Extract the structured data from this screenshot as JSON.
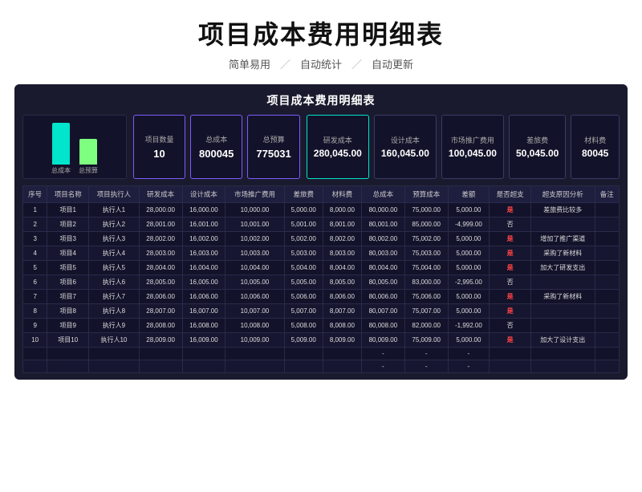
{
  "page": {
    "main_title": "项目成本费用明细表",
    "subtitle_items": [
      "简单易用",
      "自动统计",
      "自动更新"
    ],
    "subtitle_divider": "／"
  },
  "sheet": {
    "title": "项目成本费用明细表",
    "chart": {
      "bars": [
        {
          "label": "总成本",
          "height": 52,
          "color": "#00e5cc"
        },
        {
          "label": "总预算",
          "height": 32,
          "color": "#7fff7f"
        }
      ]
    },
    "stat_boxes": [
      {
        "label": "项目数量",
        "value": "10"
      },
      {
        "label": "总成本",
        "value": "800045"
      },
      {
        "label": "总预算",
        "value": "775031"
      }
    ],
    "right_stats": [
      {
        "label": "研发成本",
        "value": "280,045.00"
      },
      {
        "label": "设计成本",
        "value": "160,045.00"
      },
      {
        "label": "市场推广费用",
        "value": "100,045.00"
      },
      {
        "label": "差旅费",
        "value": "50,045.00"
      },
      {
        "label": "材料费",
        "value": "80045"
      }
    ],
    "table": {
      "headers": [
        "序号",
        "项目名称",
        "项目执行人",
        "研发成本",
        "设计成本",
        "市场推广费用",
        "差旅费",
        "材料费",
        "总成本",
        "预算成本",
        "差额",
        "是否超支",
        "超支原因分析",
        "备注"
      ],
      "rows": [
        [
          "1",
          "项目1",
          "执行人1",
          "28,000.00",
          "16,000.00",
          "10,000.00",
          "5,000.00",
          "8,000.00",
          "80,000.00",
          "75,000.00",
          "5,000.00",
          "是",
          "差旅费比较多",
          ""
        ],
        [
          "2",
          "项目2",
          "执行人2",
          "28,001.00",
          "16,001.00",
          "10,001.00",
          "5,001.00",
          "8,001.00",
          "80,001.00",
          "85,000.00",
          "-4,999.00",
          "否",
          "",
          ""
        ],
        [
          "3",
          "项目3",
          "执行人3",
          "28,002.00",
          "16,002.00",
          "10,002.00",
          "5,002.00",
          "8,002.00",
          "80,002.00",
          "75,002.00",
          "5,000.00",
          "是",
          "增加了推广渠道",
          ""
        ],
        [
          "4",
          "项目4",
          "执行人4",
          "28,003.00",
          "16,003.00",
          "10,003.00",
          "5,003.00",
          "8,003.00",
          "80,003.00",
          "75,003.00",
          "5,000.00",
          "是",
          "采购了新材料",
          ""
        ],
        [
          "5",
          "项目5",
          "执行人5",
          "28,004.00",
          "16,004.00",
          "10,004.00",
          "5,004.00",
          "8,004.00",
          "80,004.00",
          "75,004.00",
          "5,000.00",
          "是",
          "加大了研发支出",
          ""
        ],
        [
          "6",
          "项目6",
          "执行人6",
          "28,005.00",
          "16,005.00",
          "10,005.00",
          "5,005.00",
          "8,005.00",
          "80,005.00",
          "83,000.00",
          "-2,995.00",
          "否",
          "",
          ""
        ],
        [
          "7",
          "项目7",
          "执行人7",
          "28,006.00",
          "16,006.00",
          "10,006.00",
          "5,006.00",
          "8,006.00",
          "80,006.00",
          "75,006.00",
          "5,000.00",
          "是",
          "采购了新材料",
          ""
        ],
        [
          "8",
          "项目8",
          "执行人8",
          "28,007.00",
          "16,007.00",
          "10,007.00",
          "5,007.00",
          "8,007.00",
          "80,007.00",
          "75,007.00",
          "5,000.00",
          "是",
          "",
          ""
        ],
        [
          "9",
          "项目9",
          "执行人9",
          "28,008.00",
          "16,008.00",
          "10,008.00",
          "5,008.00",
          "8,008.00",
          "80,008.00",
          "82,000.00",
          "-1,992.00",
          "否",
          "",
          ""
        ],
        [
          "10",
          "项目10",
          "执行人10",
          "28,009.00",
          "16,009.00",
          "10,009.00",
          "5,009.00",
          "8,009.00",
          "80,009.00",
          "75,009.00",
          "5,000.00",
          "是",
          "加大了设计支出",
          ""
        ]
      ]
    }
  }
}
